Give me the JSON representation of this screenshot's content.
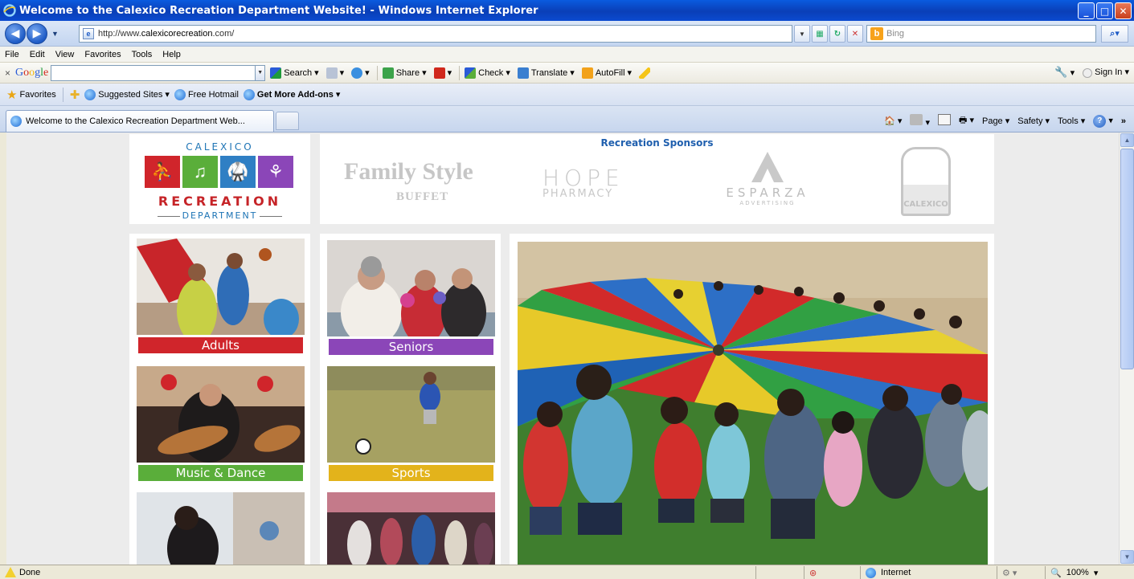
{
  "window": {
    "title": "Welcome to the Calexico Recreation Department Website! - Windows Internet Explorer",
    "controls": {
      "minimize": "_",
      "maximize": "□",
      "close": "✕"
    }
  },
  "address_bar": {
    "url_prefix": "http://www.",
    "url_domain": "calexicorecreation",
    "url_suffix": ".com/",
    "search_placeholder": "Bing",
    "search_provider_letter": "b"
  },
  "menu": [
    "File",
    "Edit",
    "View",
    "Favorites",
    "Tools",
    "Help"
  ],
  "google_toolbar": {
    "close": "×",
    "logo_letters": [
      "G",
      "o",
      "o",
      "g",
      "l",
      "e"
    ],
    "search_label": "Search",
    "share_label": "Share",
    "check_label": "Check",
    "translate_label": "Translate",
    "autofill_label": "AutoFill",
    "signin_label": "Sign In"
  },
  "favorites_bar": {
    "favorites_label": "Favorites",
    "items": [
      "Suggested Sites",
      "Free Hotmail",
      "Get More Add-ons"
    ]
  },
  "tabs": {
    "active_tab": "Welcome to the Calexico Recreation Department Web..."
  },
  "command_bar": {
    "page": "Page",
    "safety": "Safety",
    "tools": "Tools",
    "more": "»"
  },
  "site": {
    "logo": {
      "city": "CALEXICO",
      "word": "RECREATION",
      "department": "DEPARTMENT"
    },
    "sponsors": {
      "title": "Recreation Sponsors",
      "family_style": {
        "main": "Family Style",
        "sub": "BUFFET"
      },
      "hope": {
        "main": "HOPE",
        "sub": "PHARMACY"
      },
      "esparza": {
        "main": "ESPARZA",
        "sub": "ADVERTISING"
      },
      "seal": "CALEXICO"
    },
    "programs": [
      {
        "label": "Adults",
        "color": "#D0252B"
      },
      {
        "label": "Seniors",
        "color": "#8B46B8"
      },
      {
        "label": "Music & Dance",
        "color": "#5AAE3A"
      },
      {
        "label": "Sports",
        "color": "#E3B31B"
      }
    ],
    "logo_tile_colors": [
      "#D0252B",
      "#5AAE3A",
      "#2F7FC4",
      "#8B46B8"
    ]
  },
  "status_bar": {
    "status": "Done",
    "zone": "Internet",
    "zoom": "100%"
  }
}
